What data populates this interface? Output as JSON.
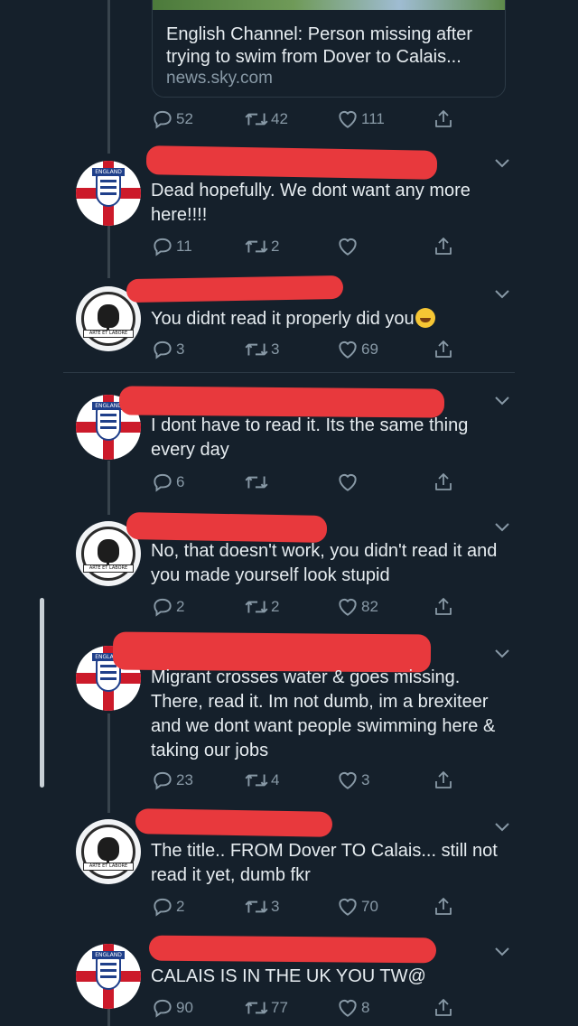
{
  "link_card": {
    "title": "English Channel: Person missing after trying to swim from Dover to Calais...",
    "domain": "news.sky.com"
  },
  "main_actions": {
    "replies": "52",
    "retweets": "42",
    "likes": "111"
  },
  "tweets": [
    {
      "avatar": "england-badge",
      "text": "Dead hopefully. We dont want any more here!!!!",
      "replies": "11",
      "retweets": "2",
      "likes": ""
    },
    {
      "avatar": "club-badge",
      "text": "You didnt read it properly did you",
      "emoji": "rolling-on-floor-laughing",
      "replies": "3",
      "retweets": "3",
      "likes": "69"
    },
    {
      "avatar": "england-badge",
      "text": "I dont have to read it. Its the same thing every day",
      "replies": "6",
      "retweets": "",
      "likes": ""
    },
    {
      "avatar": "club-badge",
      "text": "No, that doesn't work, you didn't read it and you made yourself look stupid",
      "replies": "2",
      "retweets": "2",
      "likes": "82"
    },
    {
      "avatar": "england-badge",
      "text": "Migrant crosses water & goes missing. There, read it. Im not dumb, im a brexiteer and we dont want people swimming here & taking our jobs",
      "replies": "23",
      "retweets": "4",
      "likes": "3"
    },
    {
      "avatar": "club-badge",
      "text": "The title.. FROM Dover TO Calais... still not read it yet, dumb fkr",
      "replies": "2",
      "retweets": "3",
      "likes": "70"
    },
    {
      "avatar": "england-badge",
      "text": "CALAIS IS IN THE UK YOU TW@",
      "replies": "90",
      "retweets": "77",
      "likes": "8"
    }
  ],
  "badges": {
    "england": "ENGLAND",
    "club_motto": "ARTE ET LABORE"
  },
  "colors": {
    "background": "#15202b",
    "text": "#e6ecf0",
    "muted": "#8899a6",
    "redaction": "#e8393d"
  }
}
